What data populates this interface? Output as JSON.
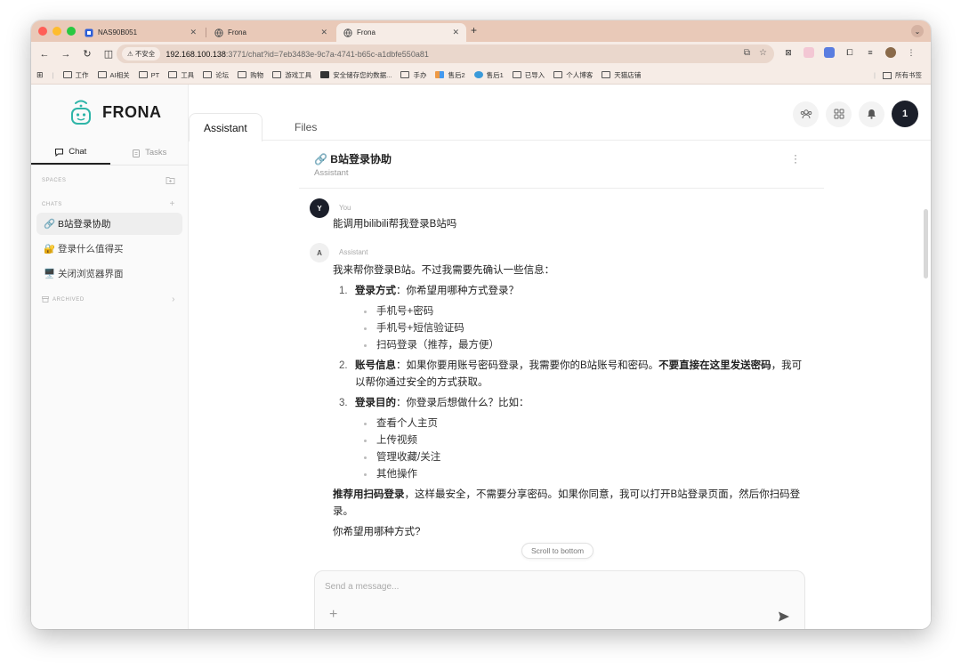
{
  "browser": {
    "tabs": [
      {
        "title": "NAS90B051"
      },
      {
        "title": "Frona"
      },
      {
        "title": "Frona"
      }
    ],
    "omnibox": {
      "security_label": "不安全",
      "url_host": "192.168.100.138",
      "url_rest": ":3771/chat?id=7eb3483e-9c7a-4741-b65c-a1dbfe550a81"
    },
    "bookmarks": [
      {
        "label": "工作"
      },
      {
        "label": "AI相关"
      },
      {
        "label": "PT"
      },
      {
        "label": "工具"
      },
      {
        "label": "论坛"
      },
      {
        "label": "购物"
      },
      {
        "label": "游戏工具"
      },
      {
        "label": "安全储存您的数据..."
      },
      {
        "label": "手办"
      },
      {
        "label": "售后2"
      },
      {
        "label": "售后1"
      },
      {
        "label": "已导入"
      },
      {
        "label": "个人博客"
      },
      {
        "label": "天猫店铺"
      }
    ],
    "all_bookmarks_label": "所有书签"
  },
  "app": {
    "brand": "FRONA",
    "sidebar": {
      "tabs": [
        {
          "label": "Chat"
        },
        {
          "label": "Tasks"
        }
      ],
      "sections": {
        "spaces": "SPACES",
        "chats": "CHATS",
        "archived": "ARCHIVED"
      },
      "chats": [
        {
          "label": "🔗 B站登录协助"
        },
        {
          "label": "🔐 登录什么值得买"
        },
        {
          "label": "🖥️ 关闭浏览器界面"
        }
      ]
    },
    "main_tabs": [
      {
        "label": "Assistant"
      },
      {
        "label": "Files"
      }
    ],
    "user_avatar": "1",
    "conversation": {
      "title": "🔗 B站登录协助",
      "subtitle": "Assistant"
    },
    "messages": {
      "user": {
        "avatar": "Y",
        "author": "You",
        "text": "能调用bilibili帮我登录B站吗"
      },
      "assistant": {
        "avatar": "A",
        "author": "Assistant",
        "intro": "我来帮你登录B站。不过我需要先确认一些信息：",
        "items": [
          {
            "num": "1.",
            "bold": "登录方式",
            "text": "：你希望用哪种方式登录？",
            "subitems": [
              "手机号+密码",
              "手机号+短信验证码",
              "扫码登录（推荐，最方便）"
            ]
          },
          {
            "num": "2.",
            "bold": "账号信息",
            "text": "：如果你要用账号密码登录，我需要你的B站账号和密码。",
            "bold2": "不要直接在这里发送密码",
            "text2": "，我可以帮你通过安全的方式获取。"
          },
          {
            "num": "3.",
            "bold": "登录目的",
            "text": "：你登录后想做什么？比如：",
            "subitems": [
              "查看个人主页",
              "上传视频",
              "管理收藏/关注",
              "其他操作"
            ]
          }
        ],
        "recommend_bold": "推荐用扫码登录",
        "recommend_text": "，这样最安全，不需要分享密码。如果你同意，我可以打开B站登录页面，然后你扫码登录。",
        "closing": "你希望用哪种方式?"
      }
    },
    "scroll_to_bottom": "Scroll to bottom",
    "composer": {
      "placeholder": "Send a message..."
    }
  }
}
